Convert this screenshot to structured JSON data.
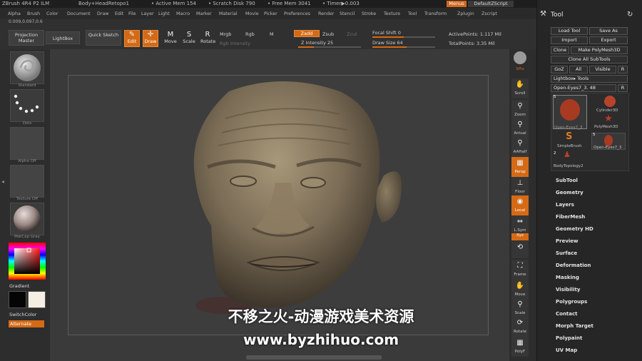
{
  "titlebar": {
    "app": "ZBrush 4R4 P2 ILM",
    "document": "Body+HeadRetopo1",
    "active_mem": "• Active Mem 154",
    "scratch_disk": "• Scratch Disk 790",
    "free_mem": "• Free Mem 3041",
    "timer": "• Timer▶0.003",
    "menus_button": "Menus",
    "script_button": "DefaultZScript"
  },
  "menubar": [
    "Alpha",
    "Brush",
    "Color",
    "Document",
    "Draw",
    "Edit",
    "File",
    "Layer",
    "Light",
    "Macro",
    "Marker",
    "Material",
    "Movie",
    "Picker",
    "Preferences",
    "Render",
    "Stencil",
    "Stroke",
    "Texture",
    "Tool",
    "Transform",
    "Zplugin",
    "Zscript"
  ],
  "shelf": {
    "coords": "0.009,0.097,0.6",
    "projection_master": "Projection Master",
    "lightbox": "LightBox",
    "quick_sketch": "Quick Sketch",
    "edit": "Edit",
    "draw": "Draw",
    "move": "Move",
    "scale": "Scale",
    "rotate": "Rotate",
    "mrgb": "Mrgb",
    "rgb": "Rgb",
    "m": "M",
    "rgb_intensity": "Rgb Intensity",
    "zadd": "Zadd",
    "zsub": "Zsub",
    "zcut": "Zcut",
    "z_intensity": "Z Intensity 25",
    "focal_shift": "Focal Shift 0",
    "draw_size": "Draw Size 64",
    "active_points": "ActivePoints: 1.117 Mil",
    "total_points": "TotalPoints: 3.35 Mil"
  },
  "left": {
    "brush_label": "Standard",
    "stroke_label": "Dots",
    "alpha_label": "Alpha Off",
    "texture_label": "Texture Off",
    "material_label": "MatCap Gray",
    "gradient": "Gradient",
    "switchcolor": "SwitchColor",
    "alternate": "Alternate"
  },
  "right_toolbar": [
    "SPix",
    "Scroll",
    "Zoom",
    "Actual",
    "AAHalf",
    "Persp",
    "Floor",
    "Local",
    "L.Sym",
    "Xyz",
    "",
    "Frame",
    "Move",
    "Scale",
    "Rotate",
    "PolyF"
  ],
  "tool": {
    "title": "Tool",
    "load_tool": "Load Tool",
    "save_as": "Save As",
    "import": "Import",
    "export": "Export",
    "clone": "Clone",
    "make_polymesh": "Make PolyMesh3D",
    "clone_all": "Clone All SubTools",
    "goz": "GoZ",
    "all": "All",
    "visible": "Visible",
    "r": "R",
    "lightbox_tools": "Lightbox▸ Tools",
    "current": "Open-Eyes7_3. 48",
    "thumbs": [
      "Open-Eyes7_3",
      "Cylinder3D",
      "PolyMesh3D",
      "SimpleBrush",
      "Open-Eyes7_3",
      "BodyTopology2"
    ],
    "thumb_count": "5",
    "thumb_count2": "5",
    "thumb_count3": "2",
    "menu": [
      "SubTool",
      "Geometry",
      "Layers",
      "FiberMesh",
      "Geometry HD",
      "Preview",
      "Surface",
      "Deformation",
      "Masking",
      "Visibility",
      "Polygroups",
      "Contact",
      "Morph Target",
      "Polypaint",
      "UV Map"
    ]
  },
  "watermark": {
    "line1": "不移之火-动漫游戏美术资源",
    "line2": "www.byzhihuo.com"
  }
}
